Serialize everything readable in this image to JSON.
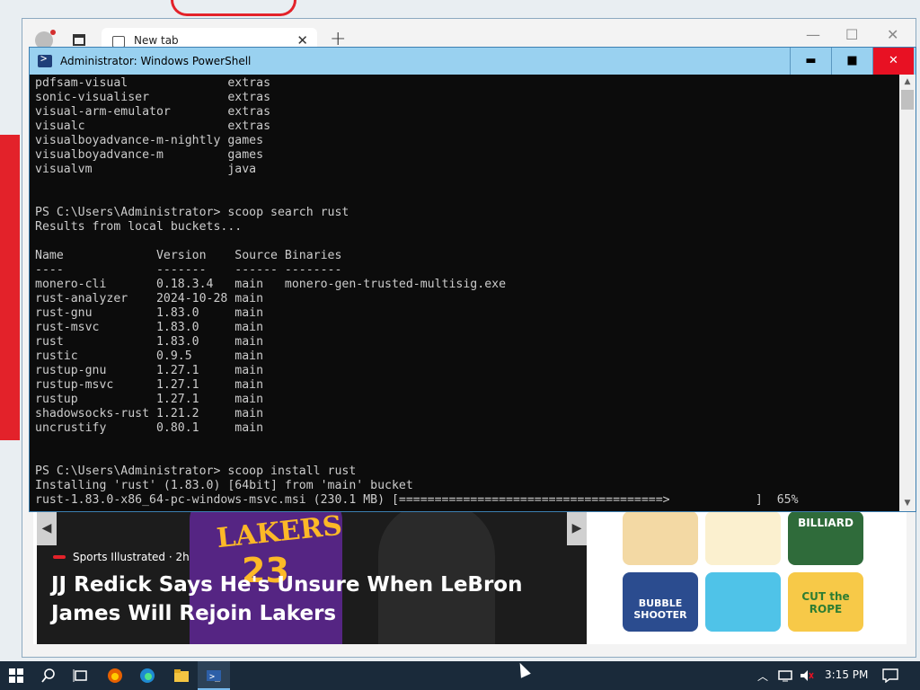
{
  "browser": {
    "tab_title": "New tab",
    "new_tab_symbol": "+",
    "close_symbol": "✕",
    "minimize_symbol": "—",
    "maximize_symbol": "☐",
    "news": {
      "source": "Sports Illustrated · 2h",
      "title": "JJ Redick Says He's Unsure When LeBron James Will Rejoin Lakers",
      "jersey_text": "LAKERS",
      "jersey_number": "23"
    },
    "games": [
      "BILLIARD",
      "BUBBLE SHOOTER",
      "CUT the ROPE"
    ]
  },
  "powershell": {
    "title": "Administrator: Windows PowerShell",
    "lines": [
      "pdfsam-visual              extras",
      "sonic-visualiser           extras",
      "visual-arm-emulator        extras",
      "visualc                    extras",
      "visualboyadvance-m-nightly games",
      "visualboyadvance-m         games",
      "visualvm                   java",
      "",
      "",
      "PS C:\\Users\\Administrator> scoop search rust",
      "Results from local buckets...",
      "",
      "Name             Version    Source Binaries",
      "----             -------    ------ --------",
      "monero-cli       0.18.3.4   main   monero-gen-trusted-multisig.exe",
      "rust-analyzer    2024-10-28 main",
      "rust-gnu         1.83.0     main",
      "rust-msvc        1.83.0     main",
      "rust             1.83.0     main",
      "rustic           0.9.5      main",
      "rustup-gnu       1.27.1     main",
      "rustup-msvc      1.27.1     main",
      "rustup           1.27.1     main",
      "shadowsocks-rust 1.21.2     main",
      "uncrustify       0.80.1     main",
      "",
      "",
      "PS C:\\Users\\Administrator> scoop install rust",
      "Installing 'rust' (1.83.0) [64bit] from 'main' bucket",
      "rust-1.83.0-x86_64-pc-windows-msvc.msi (230.1 MB) [=====================================>            ]  65%"
    ],
    "download_progress": 0.65
  },
  "taskbar": {
    "time": "3:15 PM"
  }
}
